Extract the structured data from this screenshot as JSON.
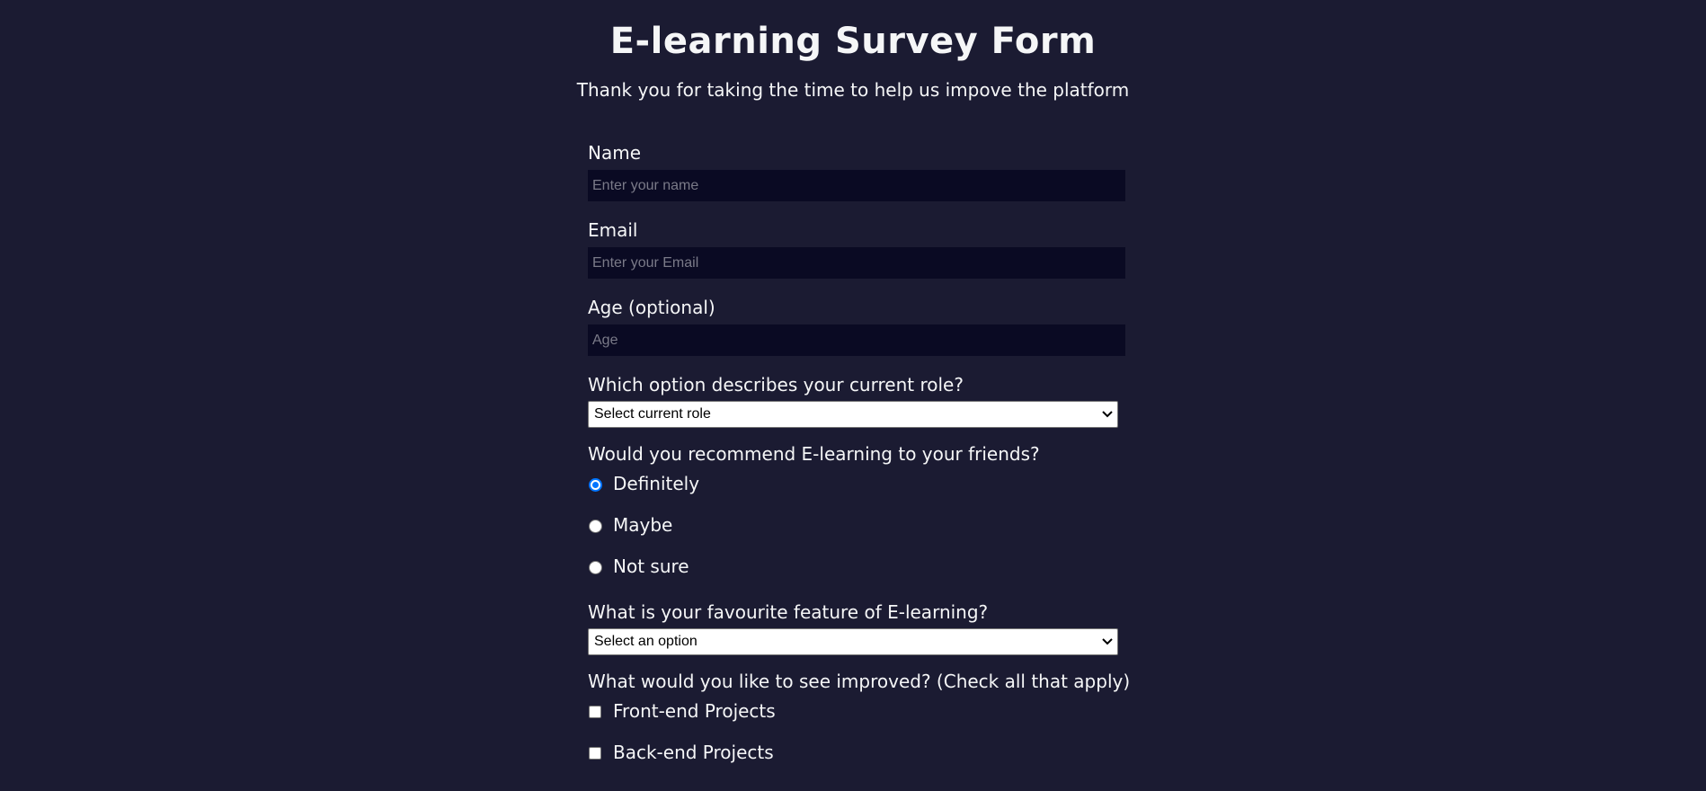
{
  "header": {
    "title": "E-learning Survey Form",
    "description": "Thank you for taking the time to help us impove the platform"
  },
  "form": {
    "name": {
      "label": "Name",
      "placeholder": "Enter your name"
    },
    "email": {
      "label": "Email",
      "placeholder": "Enter your Email"
    },
    "age": {
      "label": "Age (optional)",
      "placeholder": "Age"
    },
    "role": {
      "label": "Which option describes your current role?",
      "selected": "Select current role"
    },
    "recommend": {
      "label": "Would you recommend E-learning to your friends?",
      "options": [
        "Definitely",
        "Maybe",
        "Not sure"
      ],
      "selected": "Definitely"
    },
    "feature": {
      "label": "What is your favourite feature of E-learning?",
      "selected": "Select an option"
    },
    "improve": {
      "label": "What would you like to see improved? (Check all that apply)",
      "options": [
        "Front-end Projects",
        "Back-end Projects"
      ]
    }
  },
  "colors": {
    "background": "#1b1b32",
    "input_background": "#0a0a23",
    "text": "#f5f6f7",
    "radio_accent": "#0075ff"
  },
  "icons": {
    "select_arrow": "chevron-down-icon"
  }
}
